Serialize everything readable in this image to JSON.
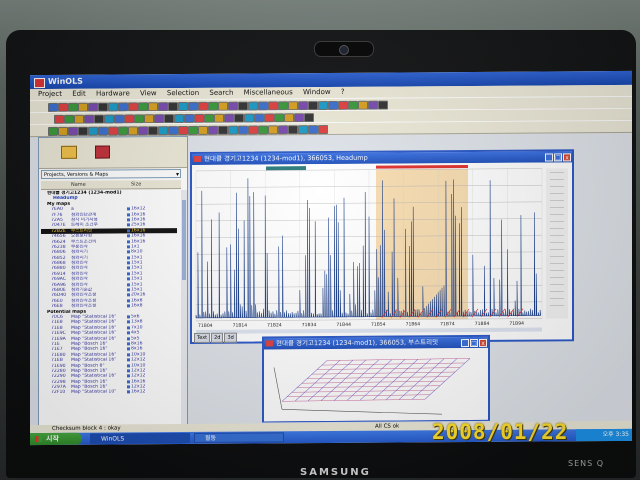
{
  "photo": {
    "brand": "SAMSUNG",
    "brand_sub": "SENS Q",
    "date_stamp": "2008/01/22"
  },
  "app": {
    "title": "WinOLS",
    "menu": [
      "Project",
      "Edit",
      "Hardware",
      "View",
      "Selection",
      "Search",
      "Miscellaneous",
      "Window",
      "?"
    ]
  },
  "left_panel": {
    "selector": "Projects, Versions & Maps",
    "header": "Name",
    "header_size": "Size",
    "project": "현대클 경기고1234 (1234-mod1)",
    "groups": [
      {
        "label": "Headump",
        "kind": "sub"
      },
      {
        "label": "My maps",
        "kind": "grp"
      }
    ],
    "rows": [
      {
        "addr": "7EA0",
        "name": "a",
        "size": "16x12"
      },
      {
        "addr": "7F76",
        "name": "점화진단관계",
        "size": "16x16"
      },
      {
        "addr": "72A5",
        "name": "잠자 미기사용",
        "size": "16x16"
      },
      {
        "addr": "7047E",
        "name": "트레이 조건부",
        "size": "25x16"
      },
      {
        "addr": "72B2E",
        "name": "부스트리밋",
        "size": "16x16",
        "hl": true
      },
      {
        "addr": "74656",
        "name": "오픈보다된",
        "size": "16x16"
      },
      {
        "addr": "76624",
        "name": "부스트조건의",
        "size": "16x16"
      },
      {
        "addr": "76238",
        "name": "부분진각",
        "size": "1x1"
      },
      {
        "addr": "76806",
        "name": "점화시기",
        "size": "8x10"
      },
      {
        "addr": "76852",
        "name": "점화시기",
        "size": "15x1"
      },
      {
        "addr": "76868",
        "name": "점화진각",
        "size": "15x1"
      },
      {
        "addr": "76880",
        "name": "점화진각",
        "size": "15x1"
      },
      {
        "addr": "76914",
        "name": "점화진각",
        "size": "15x1"
      },
      {
        "addr": "769AC",
        "name": "점화진각",
        "size": "15x1"
      },
      {
        "addr": "76A96",
        "name": "점화진각",
        "size": "15x1"
      },
      {
        "addr": "76B0E",
        "name": "점화기준값",
        "size": "15x1"
      },
      {
        "addr": "76D40",
        "name": "점화진각조정",
        "size": "20x16"
      },
      {
        "addr": "76E0",
        "name": "점화진각조정",
        "size": "16x8"
      },
      {
        "addr": "76E8",
        "name": "점화진각조정",
        "size": "16x8"
      },
      {
        "addr": "",
        "name": "Potential maps",
        "size": "",
        "kind": "grp"
      },
      {
        "addr": "70C6",
        "name": "Map \"Statistical 16\"",
        "size": "5x6"
      },
      {
        "addr": "71E8",
        "name": "Map \"Statistical 16\"",
        "size": "13x8"
      },
      {
        "addr": "71E8",
        "name": "Map \"Statistical 16\"",
        "size": "7x10"
      },
      {
        "addr": "71E9C",
        "name": "Map \"Statistical 16\"",
        "size": "4x5"
      },
      {
        "addr": "71E9A",
        "name": "Map \"Statistical 16\"",
        "size": "5x5"
      },
      {
        "addr": "71E",
        "name": "Map \"Bosch 16\"",
        "size": "8x16"
      },
      {
        "addr": "71E7",
        "name": "Map \"Bosch 16\"",
        "size": "8x16"
      },
      {
        "addr": "71E80",
        "name": "Map \"Statistical 16\"",
        "size": "10x10"
      },
      {
        "addr": "71EB",
        "name": "Map \"Statistical 16\"",
        "size": "12x12"
      },
      {
        "addr": "71E90",
        "name": "Map \"Bosch 8\"",
        "size": "10x10"
      },
      {
        "addr": "72280",
        "name": "Map \"Bosch 16\"",
        "size": "12x12"
      },
      {
        "addr": "72290",
        "name": "Map \"Statistical 16\"",
        "size": "12x12"
      },
      {
        "addr": "72298",
        "name": "Map \"Bosch 16\"",
        "size": "16x16"
      },
      {
        "addr": "7297A",
        "name": "Map \"Bosch 16\"",
        "size": "12x12"
      },
      {
        "addr": "72F10",
        "name": "Map \"Statistical 10\"",
        "size": "16x12"
      }
    ]
  },
  "window_2d": {
    "title": "현대클 경기고1234 (1234-mod1), 366053, Headump",
    "tabs": [
      "Text",
      "2d",
      "3d"
    ],
    "x_ticks": [
      "71B04",
      "71B14",
      "71B24",
      "71B34",
      "71B44",
      "71B54",
      "71B64",
      "71B74",
      "71B84",
      "71B94"
    ]
  },
  "window_3d": {
    "title": "현대클 경기고1234 (1234-mod1), 366053, 부스트리밋"
  },
  "status": {
    "left": "Checksum block 4 : okay",
    "right": "All CS ok"
  },
  "taskbar": {
    "start": "시작",
    "items": [
      "WinOLS",
      "월동"
    ],
    "clock": "오후 3:35"
  },
  "colors": {
    "titlebar": "#1f4fbb",
    "highlight_band": "#f7d9a8",
    "axis_grid": "#b0b0b0",
    "trace": "#1a3f8a",
    "marker_red": "#e0312e"
  }
}
